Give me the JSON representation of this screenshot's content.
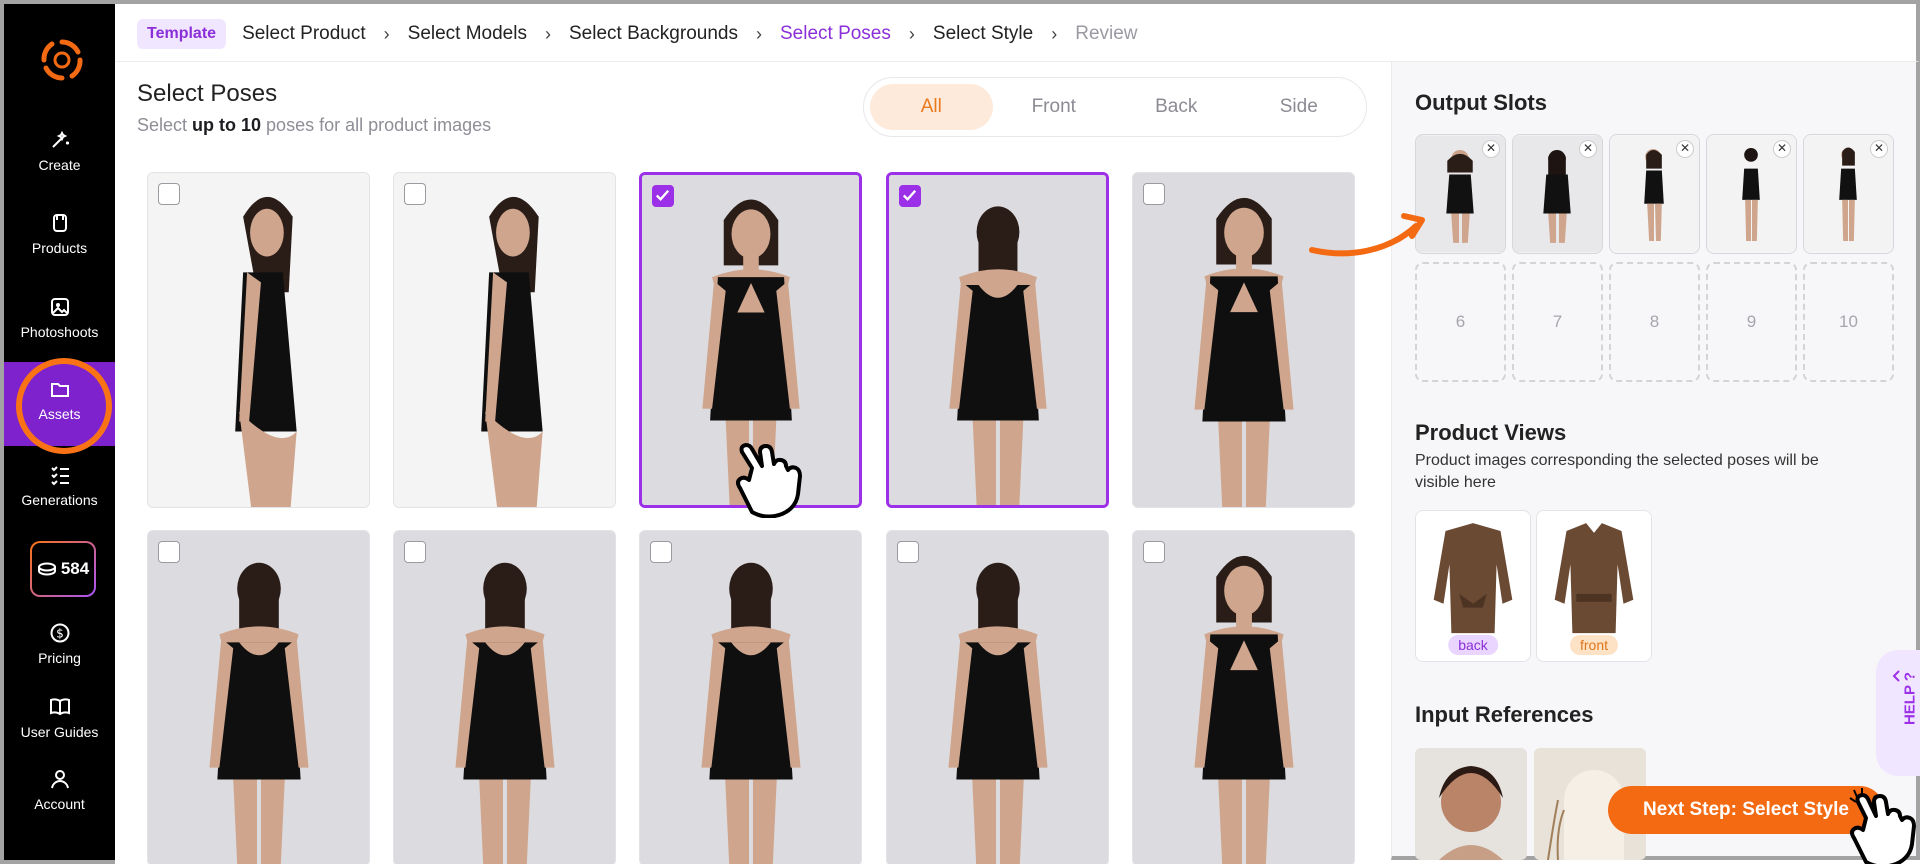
{
  "sidebar": {
    "items": [
      {
        "label": "Create",
        "icon": "magic-wand-icon"
      },
      {
        "label": "Products",
        "icon": "shirt-icon"
      },
      {
        "label": "Photoshoots",
        "icon": "image-icon"
      },
      {
        "label": "Assets",
        "icon": "folder-icon"
      },
      {
        "label": "Generations",
        "icon": "list-icon"
      },
      {
        "label": "Pricing",
        "icon": "dollar-icon"
      },
      {
        "label": "User Guides",
        "icon": "book-icon"
      },
      {
        "label": "Account",
        "icon": "user-icon"
      }
    ],
    "credits": "584",
    "active": "Assets"
  },
  "breadcrumb": {
    "tag": "Template",
    "steps": [
      "Select Product",
      "Select Models",
      "Select Backgrounds",
      "Select Poses",
      "Select Style",
      "Review"
    ],
    "current": "Select Poses"
  },
  "main": {
    "title": "Select Poses",
    "subtitle_pre": "Select ",
    "subtitle_bold": "up to 10",
    "subtitle_post": " poses for all product images",
    "filters": [
      "All",
      "Front",
      "Back",
      "Side"
    ],
    "active_filter": "All",
    "poses": [
      {
        "view": "side",
        "selected": false
      },
      {
        "view": "side",
        "selected": false
      },
      {
        "view": "front",
        "selected": true
      },
      {
        "view": "back",
        "selected": true
      },
      {
        "view": "front",
        "selected": false
      },
      {
        "view": "back",
        "selected": false
      },
      {
        "view": "back",
        "selected": false
      },
      {
        "view": "back",
        "selected": false
      },
      {
        "view": "back",
        "selected": false
      },
      {
        "view": "front",
        "selected": false
      }
    ]
  },
  "panel": {
    "output_title": "Output Slots",
    "empty_slots": [
      "6",
      "7",
      "8",
      "9",
      "10"
    ],
    "views_title": "Product Views",
    "views_desc": "Product images corresponding the selected poses will be visible here",
    "views": [
      {
        "label": "back",
        "color": "#e9d5ff",
        "text_color": "#8b2fd8"
      },
      {
        "label": "front",
        "color": "#fde2c6",
        "text_color": "#e0761c"
      }
    ],
    "refs_title": "Input References",
    "help": "HELP ?",
    "next_label": "Next Step: Select Style"
  },
  "colors": {
    "accent_purple": "#9b30e8",
    "accent_orange": "#f46a13"
  }
}
